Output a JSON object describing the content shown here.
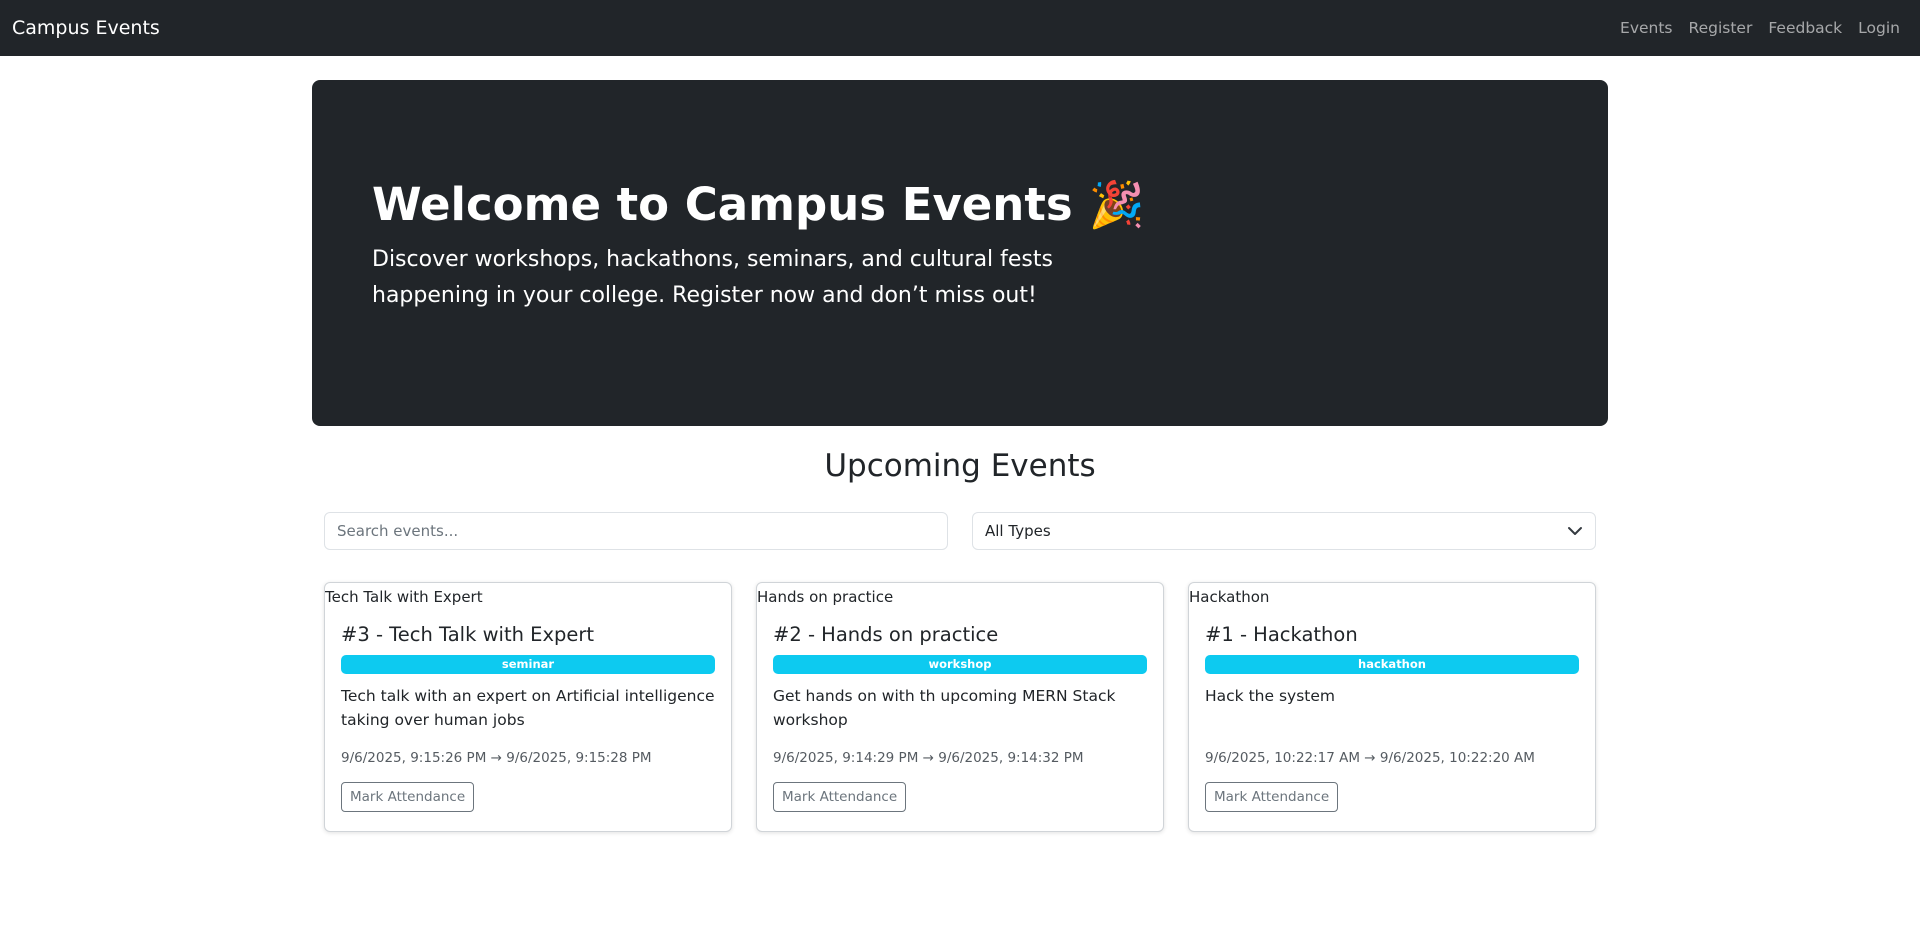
{
  "navbar": {
    "brand": "Campus Events",
    "links": [
      "Events",
      "Register",
      "Feedback",
      "Login"
    ]
  },
  "hero": {
    "title": "Welcome to Campus Events",
    "emoji": "🎉",
    "lead": "Discover workshops, hackathons, seminars, and cultural fests happening in your college. Register now and don’t miss out!"
  },
  "section": {
    "title": "Upcoming Events"
  },
  "filters": {
    "search_placeholder": "Search events...",
    "type_selected": "All Types"
  },
  "events": [
    {
      "image_alt": "Tech Talk with Expert",
      "title": "#3 - Tech Talk with Expert",
      "type": "seminar",
      "description": "Tech talk with an expert on Artificial intelligence taking over human jobs",
      "time": "9/6/2025, 9:15:26 PM → 9/6/2025, 9:15:28 PM",
      "button": "Mark Attendance"
    },
    {
      "image_alt": "Hands on practice",
      "title": "#2 - Hands on practice",
      "type": "workshop",
      "description": "Get hands on with th upcoming MERN Stack workshop",
      "time": "9/6/2025, 9:14:29 PM → 9/6/2025, 9:14:32 PM",
      "button": "Mark Attendance"
    },
    {
      "image_alt": "Hackathon",
      "title": "#1 - Hackathon",
      "type": "hackathon",
      "description": "Hack the system",
      "time": "9/6/2025, 10:22:17 AM → 9/6/2025, 10:22:20 AM",
      "button": "Mark Attendance"
    }
  ],
  "colors": {
    "dark": "#212529",
    "badge": "#0dcaf0",
    "muted": "#6c757d"
  }
}
